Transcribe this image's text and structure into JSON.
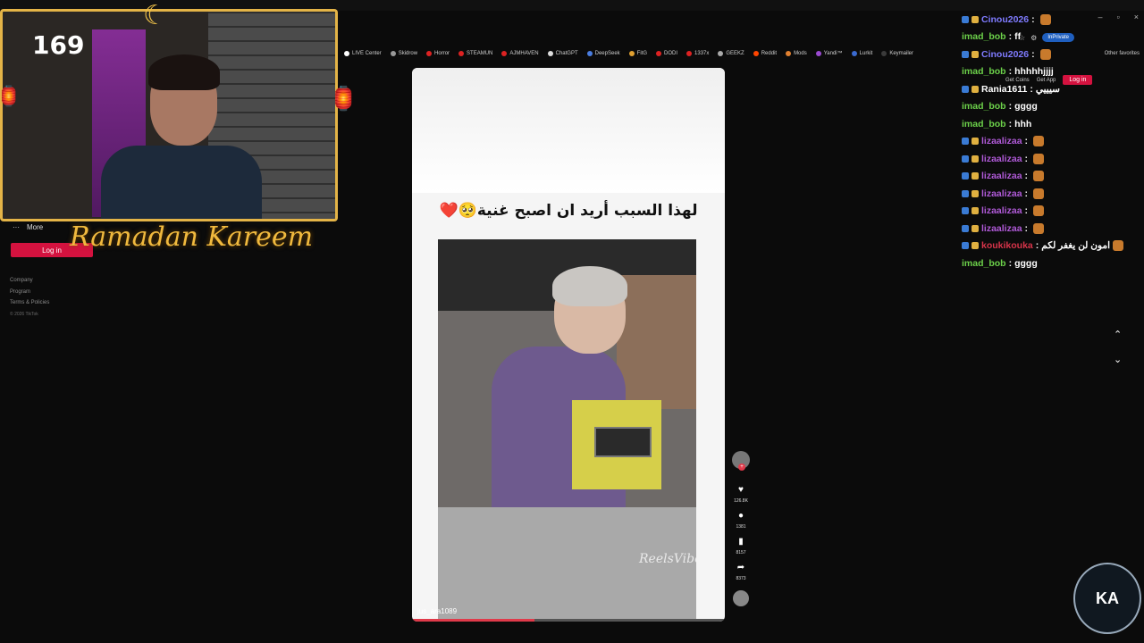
{
  "browser": {
    "bookmarks": [
      {
        "label": "LIVE Center",
        "color": "#ffffff"
      },
      {
        "label": "Skidrow",
        "color": "#999999"
      },
      {
        "label": "Horror",
        "color": "#d22"
      },
      {
        "label": "STEAMUN",
        "color": "#d22"
      },
      {
        "label": "AJMHAVEN",
        "color": "#d22"
      },
      {
        "label": "ChatGPT",
        "color": "#ddd"
      },
      {
        "label": "DeepSeek",
        "color": "#4a7de0"
      },
      {
        "label": "FitG",
        "color": "#e0a030"
      },
      {
        "label": "DODI",
        "color": "#d22"
      },
      {
        "label": "1337x",
        "color": "#d22"
      },
      {
        "label": "GEEKZ",
        "color": "#aaa"
      },
      {
        "label": "Reddit",
        "color": "#ff4500"
      },
      {
        "label": "Mods",
        "color": "#e08030"
      },
      {
        "label": "Yandi™",
        "color": "#9a4ad0"
      },
      {
        "label": "Lurkit",
        "color": "#3a6ad0"
      },
      {
        "label": "Keymailer",
        "color": "#3a3a3a"
      }
    ],
    "other_favorites": "Other favorites",
    "inprivate": "InPrivate",
    "window_controls": [
      "–",
      "▫",
      "×"
    ]
  },
  "stream": {
    "counter": "169",
    "overlay_text": "Ramadan Kareem"
  },
  "sidebar": {
    "more_label": "More",
    "login_label": "Log in",
    "links": [
      "Company",
      "Program",
      "Terms & Policies"
    ],
    "copyright": "© 2026 TikTok"
  },
  "tiktok_header": {
    "get_coins": "Get Coins",
    "get_app": "Get App",
    "login": "Log in"
  },
  "video": {
    "caption": "لهذا السبب أريد ان اصبح غنية🥺❤️",
    "username": "jus_ara1089",
    "watermark": "ReelsVibes",
    "progress": 0.39
  },
  "actions": {
    "likes": "126.8K",
    "comments": "1381",
    "saves": "8157",
    "shares": "8373"
  },
  "chat": [
    {
      "name": "Cinou2026",
      "name_color": "#7f7bff",
      "text": "",
      "emote": true
    },
    {
      "name": "imad_bob",
      "name_color": "#6cd14a",
      "text": "ff",
      "emote": false
    },
    {
      "name": "Cinou2026",
      "name_color": "#7f7bff",
      "text": "",
      "emote": true
    },
    {
      "name": "imad_bob",
      "name_color": "#6cd14a",
      "text": "hhhhhjjjj",
      "emote": false
    },
    {
      "name": "Rania1611",
      "name_color": "#ffffff",
      "text": "سيييي",
      "emote": false
    },
    {
      "name": "imad_bob",
      "name_color": "#6cd14a",
      "text": "gggg",
      "emote": false
    },
    {
      "name": "imad_bob",
      "name_color": "#6cd14a",
      "text": "hhh",
      "emote": false
    },
    {
      "name": "lizaalizaa",
      "name_color": "#b05ad8",
      "text": "",
      "emote": true
    },
    {
      "name": "lizaalizaa",
      "name_color": "#b05ad8",
      "text": "",
      "emote": true
    },
    {
      "name": "lizaalizaa",
      "name_color": "#b05ad8",
      "text": "",
      "emote": true
    },
    {
      "name": "lizaalizaa",
      "name_color": "#b05ad8",
      "text": "",
      "emote": true
    },
    {
      "name": "lizaalizaa",
      "name_color": "#b05ad8",
      "text": "",
      "emote": true
    },
    {
      "name": "lizaalizaa",
      "name_color": "#b05ad8",
      "text": "",
      "emote": true
    },
    {
      "name": "koukikouka",
      "name_color": "#d8344a",
      "text": "امون لن يغفر لكم",
      "emote": true
    },
    {
      "name": "imad_bob",
      "name_color": "#6cd14a",
      "text": "gggg",
      "emote": false
    }
  ],
  "logo_text": "KA"
}
